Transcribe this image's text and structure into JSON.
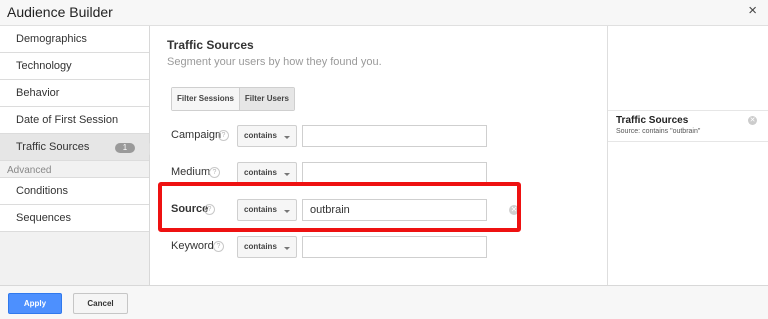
{
  "dialog": {
    "title": "Audience Builder",
    "close_glyph": "×"
  },
  "sidebar": {
    "items": [
      {
        "label": "Demographics"
      },
      {
        "label": "Technology"
      },
      {
        "label": "Behavior"
      },
      {
        "label": "Date of First Session"
      },
      {
        "label": "Traffic Sources",
        "count": "1",
        "active": true
      }
    ],
    "advanced_label": "Advanced",
    "advanced_items": [
      {
        "label": "Conditions"
      },
      {
        "label": "Sequences"
      }
    ]
  },
  "main": {
    "heading": "Traffic Sources",
    "subheading": "Segment your users by how they found you.",
    "toggle": {
      "options": [
        "Filter Sessions",
        "Filter Users"
      ],
      "selected": "Filter Users"
    },
    "filters": [
      {
        "label": "Campaign",
        "help": "?",
        "operator": "contains",
        "value": ""
      },
      {
        "label": "Medium",
        "help": "?",
        "operator": "contains",
        "value": ""
      },
      {
        "label": "Source",
        "help": "?",
        "operator": "contains",
        "value": "outbrain",
        "highlighted": true
      },
      {
        "label": "Keyword",
        "help": "?",
        "operator": "contains",
        "value": ""
      }
    ]
  },
  "summary": {
    "title": "Traffic Sources",
    "description": "Source: contains \"outbrain\""
  },
  "footer": {
    "apply_label": "Apply",
    "cancel_label": "Cancel"
  },
  "colors": {
    "highlight": "#ee1111",
    "primary_button": "#4d90fe"
  },
  "icons": {
    "close": "close-icon",
    "help": "help-icon",
    "dropdown": "caret-down-icon",
    "clear": "clear-icon"
  }
}
